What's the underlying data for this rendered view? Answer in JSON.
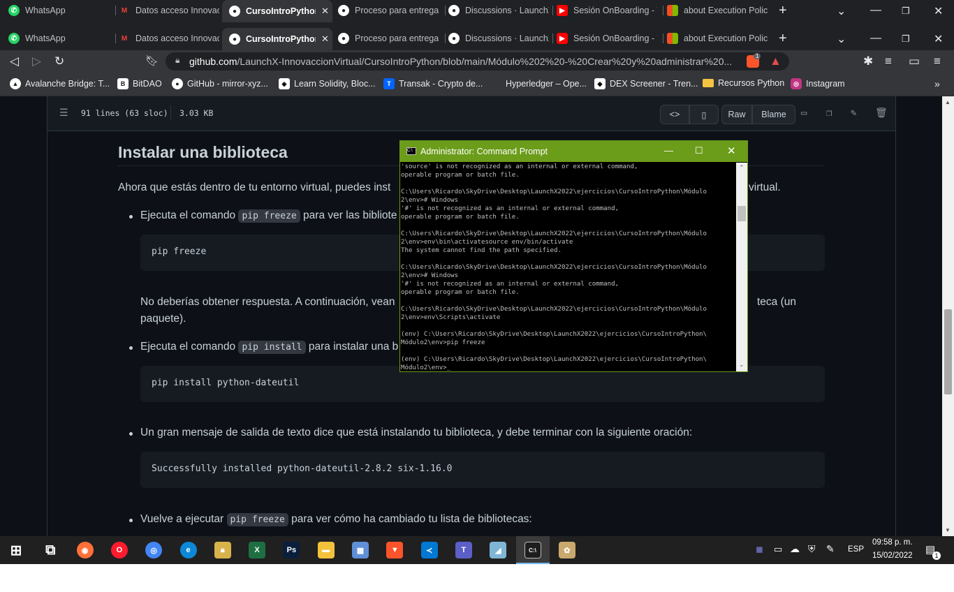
{
  "tabs_row": [
    {
      "label": "WhatsApp",
      "icon": "whatsapp-icon",
      "color": "#25d366"
    },
    {
      "label": "Datos acceso Innovacc",
      "icon": "gmail-icon",
      "color": "#ea4335"
    },
    {
      "label": "CursoIntroPython/",
      "icon": "github-icon",
      "color": "#ffffff",
      "active": true
    },
    {
      "label": "Proceso para entregar",
      "icon": "github-icon",
      "color": "#ffffff"
    },
    {
      "label": "Discussions · LaunchX·",
      "icon": "github-icon",
      "color": "#ffffff"
    },
    {
      "label": "Sesión OnBoarding - Y",
      "icon": "youtube-icon",
      "color": "#ff0000"
    },
    {
      "label": "about Execution Polici",
      "icon": "microsoft-icon",
      "color": "#f25022"
    }
  ],
  "url": {
    "host": "github.com",
    "path": "/LaunchX-InnovaccionVirtual/CursoIntroPython/blob/main/Módulo%202%20-%20Crear%20y%20administrar%20..."
  },
  "brave_badge": "1",
  "bookmarks": [
    {
      "label": "Avalanche Bridge: T...",
      "icon": "avalanche-icon",
      "color": "#e84142"
    },
    {
      "label": "BitDAO",
      "icon": "bitdao-icon",
      "color": "#ffffff"
    },
    {
      "label": "GitHub - mirror-xyz...",
      "icon": "github-icon",
      "color": "#ffffff"
    },
    {
      "label": "Learn Solidity, Bloc...",
      "icon": "solidity-icon",
      "color": "#000000"
    },
    {
      "label": "Transak - Crypto de...",
      "icon": "transak-icon",
      "color": "#0364ff"
    },
    {
      "label": "Hyperledger – Ope...",
      "icon": "hyperledger-icon",
      "color": "#2f3134"
    },
    {
      "label": "DEX Screener - Tren...",
      "icon": "dexscreener-icon",
      "color": "#ffffff"
    },
    {
      "label": "Recursos Python",
      "icon": "folder-icon",
      "color": "#f5c342"
    },
    {
      "label": "Instagram",
      "icon": "instagram-icon",
      "color": "#c13584"
    }
  ],
  "file": {
    "lines": "91 lines (63 sloc)",
    "size": "3.03 KB",
    "raw": "Raw",
    "blame": "Blame"
  },
  "content": {
    "heading": "Instalar una biblioteca",
    "p1_start": "Ahora que estás dentro de tu entorno virtual, puedes inst",
    "p1_end": "virtual.",
    "li1_start": "Ejecuta el comando",
    "li1_code": "pip freeze",
    "li1_end": "para ver las bibliote",
    "code1": "pip freeze",
    "p2_line1_start": "No deberías obtener respuesta. A continuación, vean",
    "p2_line1_end": "teca (un",
    "p2_line2": "paquete).",
    "li2_start": "Ejecuta el comando",
    "li2_code": "pip install",
    "li2_end": "para instalar una b",
    "code2": "pip install python-dateutil",
    "li3": "Un gran mensaje de salida de texto dice que está instalando tu biblioteca, y debe terminar con la siguiente oración:",
    "code3": "Successfully installed python-dateutil-2.8.2 six-1.16.0",
    "li4_start": "Vuelve a ejecutar",
    "li4_code": "pip freeze",
    "li4_end": "para ver cómo ha cambiado tu lista de bibliotecas:"
  },
  "cmd": {
    "title": "Administrator: Command Prompt",
    "lines": [
      "'source' is not recognized as an internal or external command,",
      "operable program or batch file.",
      "",
      "C:\\Users\\Ricardo\\SkyDrive\\Desktop\\LaunchX2022\\ejercicios\\CursoIntroPython\\Módulo",
      "2\\env># Windows",
      "'#' is not recognized as an internal or external command,",
      "operable program or batch file.",
      "",
      "C:\\Users\\Ricardo\\SkyDrive\\Desktop\\LaunchX2022\\ejercicios\\CursoIntroPython\\Módulo",
      "2\\env>env\\bin\\activatesource env/bin/activate",
      "The system cannot find the path specified.",
      "",
      "C:\\Users\\Ricardo\\SkyDrive\\Desktop\\LaunchX2022\\ejercicios\\CursoIntroPython\\Módulo",
      "2\\env># Windows",
      "'#' is not recognized as an internal or external command,",
      "operable program or batch file.",
      "",
      "C:\\Users\\Ricardo\\SkyDrive\\Desktop\\LaunchX2022\\ejercicios\\CursoIntroPython\\Módulo",
      "2\\env>env\\Scripts\\activate",
      "",
      "(env) C:\\Users\\Ricardo\\SkyDrive\\Desktop\\LaunchX2022\\ejercicios\\CursoIntroPython\\",
      "Módulo2\\env>pip freeze",
      "",
      "(env) C:\\Users\\Ricardo\\SkyDrive\\Desktop\\LaunchX2022\\ejercicios\\CursoIntroPython\\",
      "Módulo2\\env>_"
    ]
  },
  "taskbar": {
    "apps": [
      {
        "name": "windows-start-icon",
        "color": "#ffffff"
      },
      {
        "name": "task-view-icon",
        "color": "#ffffff"
      },
      {
        "name": "firefox-icon",
        "color": "#ff7139"
      },
      {
        "name": "opera-icon",
        "color": "#ff1b2d"
      },
      {
        "name": "chrome-icon",
        "color": "#4285f4"
      },
      {
        "name": "edge-icon",
        "color": "#0c88d7"
      },
      {
        "name": "lock-app-icon",
        "color": "#d8b24a"
      },
      {
        "name": "excel-icon",
        "color": "#1d6f42"
      },
      {
        "name": "photoshop-icon",
        "color": "#0a1f3c"
      },
      {
        "name": "file-explorer-icon",
        "color": "#f3c13a"
      },
      {
        "name": "calculator-icon",
        "color": "#5f8fd6"
      },
      {
        "name": "brave-icon",
        "color": "#fb542b"
      },
      {
        "name": "vscode-icon",
        "color": "#0078d4"
      },
      {
        "name": "teams-icon",
        "color": "#5b5fc7"
      },
      {
        "name": "notepad-icon",
        "color": "#7fb6d6"
      },
      {
        "name": "cmd-icon",
        "color": "#1e1e1e"
      },
      {
        "name": "paint-icon",
        "color": "#c9a96e"
      }
    ],
    "lang": "ESP",
    "time": "09:58 p. m.",
    "date": "15/02/2022",
    "notif_count": "1"
  }
}
